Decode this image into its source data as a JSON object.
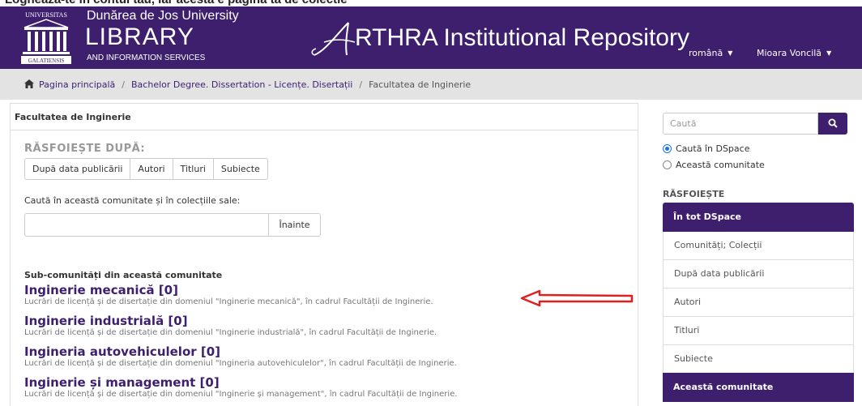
{
  "top_cut_text": "Logheaza-te in contul tau, iar acesta e pagina ta de colectie",
  "header": {
    "university": "Dunărea de Jos University",
    "library": "LIBRARY",
    "library_sub": "AND INFORMATION SERVICES",
    "repository_title": "RTHRA Institutional Repository",
    "language": "română",
    "user": "Mioara Voncilă"
  },
  "breadcrumb": {
    "home": "Pagina principală",
    "level1": "Bachelor Degree. Dissertation - Licențe. Disertații",
    "level2": "Facultatea de Inginerie"
  },
  "main": {
    "title": "Facultatea de Inginerie",
    "browse_heading": "RĂSFOIEȘTE DUPĂ:",
    "browse_buttons": [
      "După data publicării",
      "Autori",
      "Titluri",
      "Subiecte"
    ],
    "search_label": "Caută în această comunitate și în colecțiile sale:",
    "search_value": "",
    "go_label": "Înainte",
    "subcommunities_heading": "Sub-comunități din această comunitate",
    "subcommunities": [
      {
        "title": "Inginerie mecanică [0]",
        "desc": "Lucrări de licență și de disertație din domeniul \"Inginerie mecanică\", în cadrul Facultății de Inginerie."
      },
      {
        "title": "Inginerie industrială [0]",
        "desc": "Lucrări de licență și de disertație din domeniul \"Inginerie industrială\", în cadrul Facultății de Inginerie."
      },
      {
        "title": "Ingineria autovehiculelor [0]",
        "desc": "Lucrări de licență și de disertație din domeniul \"Ingineria autovehiculelor\", în cadrul Facultății de Inginerie."
      },
      {
        "title": "Inginerie și management [0]",
        "desc": "Lucrări de licență și de disertație din domeniul \"Inginerie și management\", în cadrul Facultății de Inginerie."
      }
    ]
  },
  "sidebar": {
    "search_placeholder": "Caută",
    "scope_options": [
      "Caută în DSpace",
      "Această comunitate"
    ],
    "browse_heading": "RĂSFOIEȘTE",
    "all_dspace": "În tot DSpace",
    "items": [
      "Comunități; Colecții",
      "După data publicării",
      "Autori",
      "Titluri",
      "Subiecte"
    ],
    "this_community": "Această comunitate"
  },
  "colors": {
    "brand": "#3d1f6e",
    "arrow": "#e02020"
  }
}
